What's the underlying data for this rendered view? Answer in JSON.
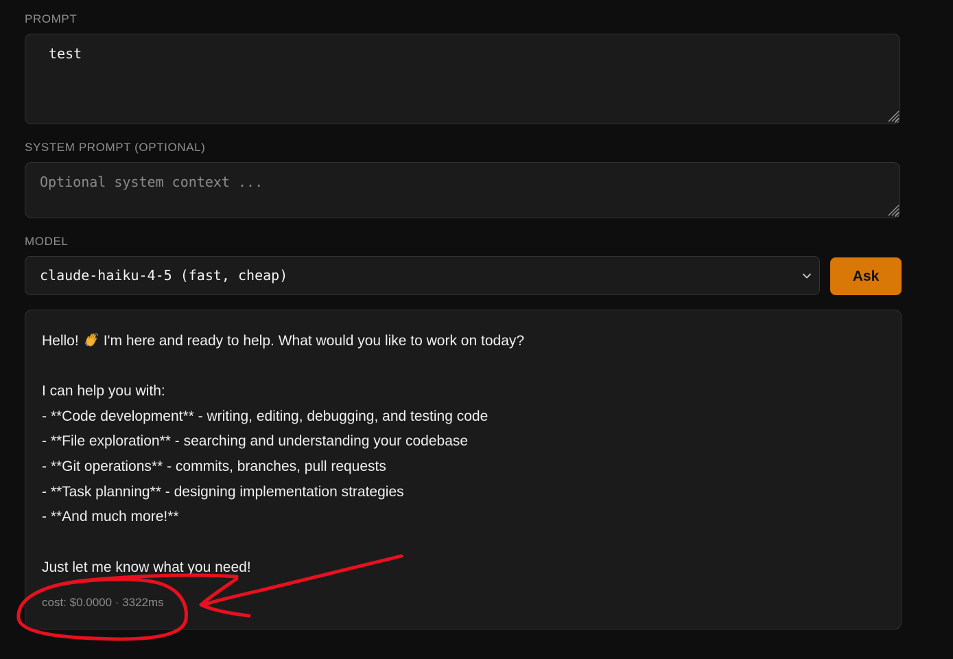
{
  "form": {
    "prompt_label": "PROMPT",
    "prompt_value": "test",
    "system_label": "SYSTEM PROMPT (OPTIONAL)",
    "system_placeholder": "Optional system context ...",
    "model_label": "MODEL",
    "model_selected": "claude-haiku-4-5 (fast, cheap)",
    "ask_label": "Ask"
  },
  "response": {
    "greeting_before": "Hello!",
    "greeting_emoji": "waving-hand-icon",
    "greeting_after": "I'm here and ready to help. What would you like to work on today?",
    "intro": "I can help you with:",
    "items": [
      "- **Code development** - writing, editing, debugging, and testing code",
      "- **File exploration** - searching and understanding your codebase",
      "- **Git operations** - commits, branches, pull requests",
      "- **Task planning** - designing implementation strategies",
      "- **And much more!**"
    ],
    "closing": "Just let me know what you need!",
    "cost": "cost: $0.0000 · 3322ms"
  },
  "colors": {
    "background": "#0e0e0e",
    "panel": "#1b1b1b",
    "accent": "#d97707",
    "annotation": "#e8101e"
  }
}
